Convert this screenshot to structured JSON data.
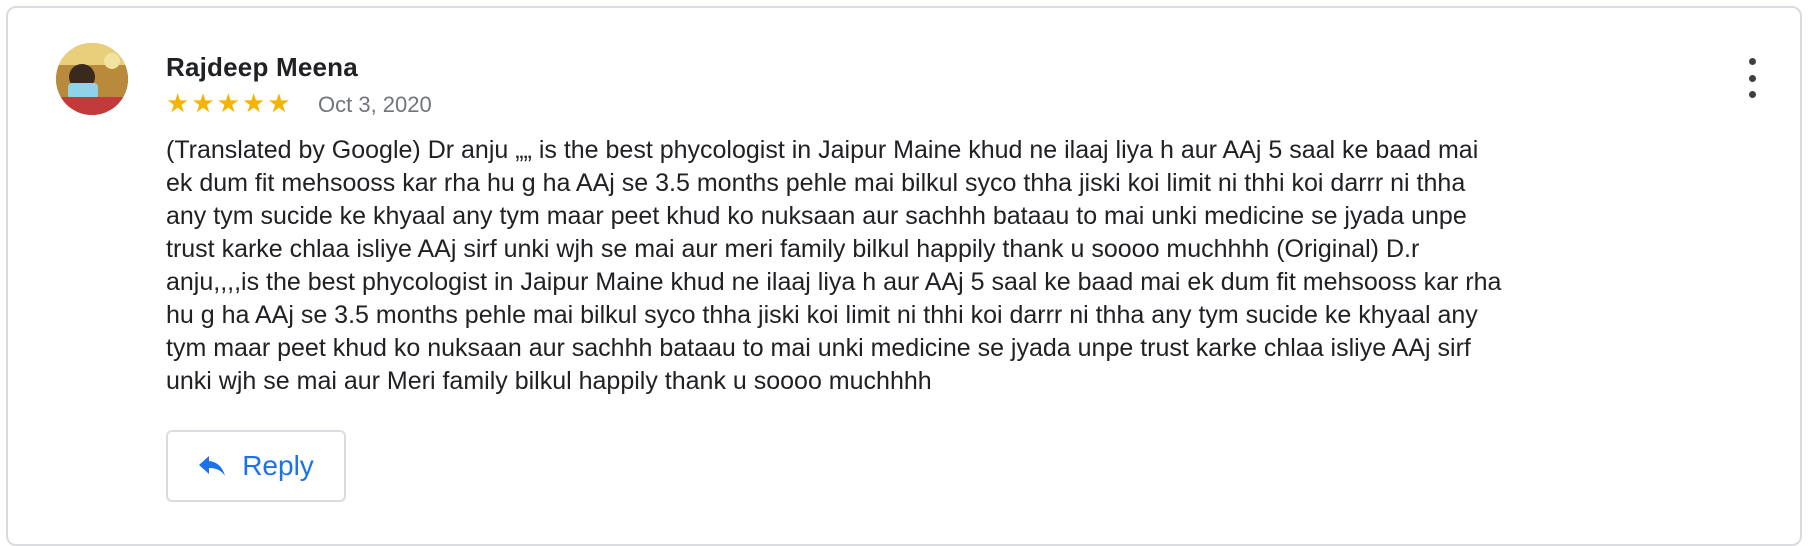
{
  "review": {
    "author": "Rajdeep Meena",
    "rating": 5,
    "stars": [
      "★",
      "★",
      "★",
      "★",
      "★"
    ],
    "date": "Oct 3, 2020",
    "text": "(Translated by Google) Dr anju „„ is the best phycologist in Jaipur Maine khud ne ilaaj liya h aur AAj 5 saal ke baad mai\nek dum fit mehsooss kar rha hu g ha AAj se 3.5 months pehle mai bilkul syco thha jiski koi limit ni thhi koi darrr ni thha\nany tym sucide ke khyaal any tym maar peet khud ko nuksaan aur sachhh bataau to mai unki medicine se jyada unpe\ntrust karke chlaa isliye AAj sirf unki wjh se mai aur meri family bilkul happily thank u soooo muchhhh (Original) D.r\nanju,,,,is the best phycologist in Jaipur Maine khud ne ilaaj liya h aur AAj 5 saal ke baad mai ek dum fit mehsooss kar rha\nhu g ha AAj se 3.5 months pehle mai bilkul syco thha jiski koi limit ni thhi koi darrr ni thha any tym sucide ke khyaal any\ntym maar peet khud ko nuksaan aur sachhh bataau to mai unki medicine se jyada unpe trust karke chlaa isliye AAj sirf\nunki wjh se mai aur Meri family bilkul happily thank u soooo muchhhh"
  },
  "actions": {
    "reply_label": "Reply",
    "reply_icon": "reply-arrow-icon",
    "more_icon": "more-vert-icon"
  },
  "colors": {
    "star": "#f4b400",
    "accent": "#1a73e8",
    "border": "#dadce0"
  }
}
